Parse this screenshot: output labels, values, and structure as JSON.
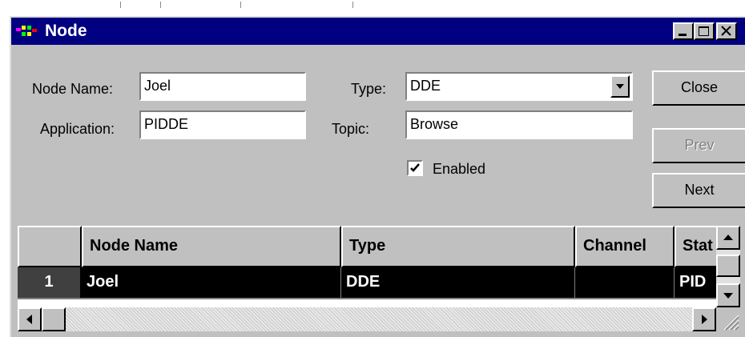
{
  "window": {
    "title": "Node"
  },
  "form": {
    "node_name_label": "Node Name:",
    "node_name_value": "Joel",
    "application_label": "Application:",
    "application_value": "PIDDE",
    "type_label": "Type:",
    "type_value": "DDE",
    "topic_label": "Topic:",
    "topic_value": "Browse",
    "enabled_label": "Enabled",
    "enabled_checked": true
  },
  "buttons": {
    "close": "Close",
    "prev": "Prev",
    "next": "Next"
  },
  "grid": {
    "columns": [
      "Node Name",
      "Type",
      "Channel",
      "Stat"
    ],
    "rows": [
      {
        "index": "1",
        "node_name": "Joel",
        "type": "DDE",
        "channel": "",
        "status": "PID"
      }
    ]
  },
  "icons": [
    "app-icon",
    "minimize-icon",
    "maximize-icon",
    "close-icon",
    "dropdown-arrow-icon",
    "scroll-up-icon",
    "scroll-down-icon",
    "scroll-left-icon",
    "scroll-right-icon",
    "size-grip-icon"
  ]
}
